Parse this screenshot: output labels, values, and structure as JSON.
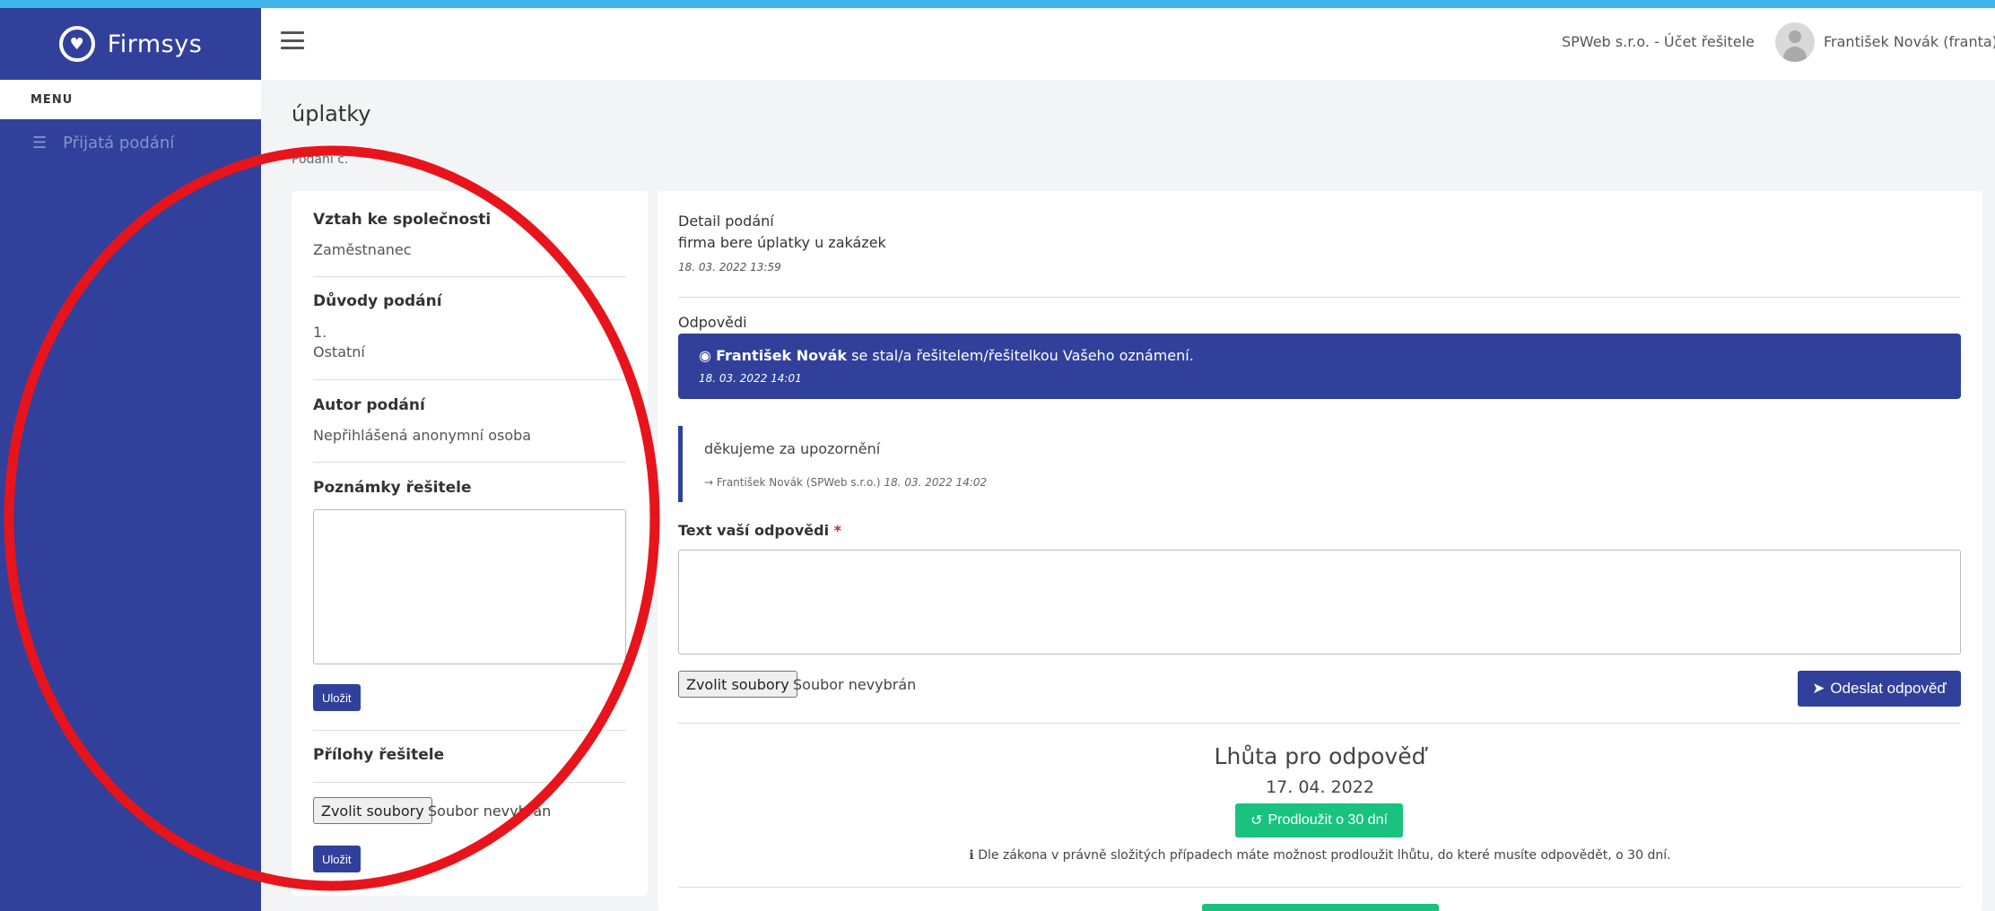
{
  "brand": {
    "name": "Firmsys",
    "logo_icon": "firmsys-logo-icon"
  },
  "sidebar": {
    "menu_header": "MENU",
    "items": [
      {
        "icon": "list-icon",
        "label": "Přijatá podání"
      }
    ]
  },
  "header": {
    "company": "SPWeb s.r.o. - Účet řešitele",
    "user": "František Novák (franta)"
  },
  "page": {
    "title": "úplatky",
    "subtitle": "Podání č."
  },
  "left_panel": {
    "relation_label": "Vztah ke společnosti",
    "relation_value": "Zaměstnanec",
    "reasons_label": "Důvody podání",
    "reasons_number": "1.",
    "reasons_value": "Ostatní",
    "author_label": "Autor podání",
    "author_value": "Nepřihlášená anonymní osoba",
    "notes_label": "Poznámky řešitele",
    "save_label": "Uložit",
    "attachments_label": "Přílohy řešitele",
    "file_button": "Zvolit soubory",
    "file_none": "Soubor nevybrán",
    "save2_label": "Uložit"
  },
  "right_panel": {
    "detail_label": "Detail podání",
    "detail_text": "firma bere úplatky u zakázek",
    "detail_time": "18. 03. 2022 13:59",
    "answers_label": "Odpovědi",
    "banner_name": "František Novák",
    "banner_text": " se stal/a řešitelem/řešitelkou Vašeho oznámení.",
    "banner_time": "18. 03. 2022 14:01",
    "reply_text": "děkujeme za upozornění",
    "reply_author": "→ František Novák (SPWeb s.r.o.) ",
    "reply_time": "18. 03. 2022 14:02",
    "answer_label": "Text vaší odpovědi",
    "answer_required": "*",
    "file_button": "Zvolit soubory",
    "file_none": "Soubor nevybrán",
    "send_label": "Odeslat odpověď",
    "deadline_title": "Lhůta pro odpověď",
    "deadline_date": "17. 04. 2022",
    "extend_label": "Prodloužit o 30 dní",
    "info_text": "Dle zákona v právně složitých případech máte možnost prodloužit lhůtu, do které musíte odpovědět, o 30 dní."
  },
  "colors": {
    "primary": "#31409a",
    "success": "#1ac27f",
    "annotation": "#e8141b",
    "top_strip": "#3fb6ea"
  }
}
